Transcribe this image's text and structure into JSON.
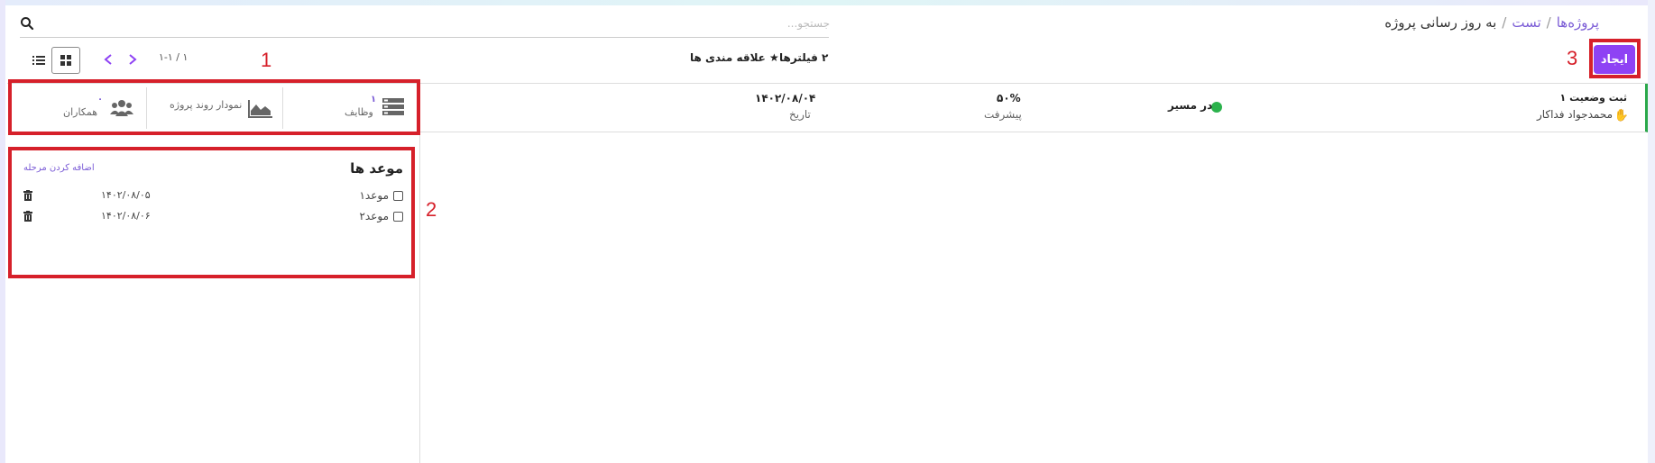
{
  "breadcrumb": {
    "root": "پروژه‌ها",
    "separator": "/",
    "project": "تست",
    "current": "به روز رسانی پروژه"
  },
  "search": {
    "placeholder": "جستجو..."
  },
  "toolbar": {
    "create_label": "ایجاد",
    "filters_label": "۲ فیلترها",
    "favorites_label": "★ علاقه مندی ها",
    "pager_text": "۱-۱ / ۱"
  },
  "annotations": {
    "one": "1",
    "two": "2",
    "three": "3"
  },
  "status_update": {
    "title": "ثبت وضعیت ۱",
    "user": "محمدجواد فداکار",
    "status": "در مسیر",
    "progress_value": "۵۰%",
    "progress_label": "پیشرفت",
    "date_value": "۱۴۰۲/۰۸/۰۴",
    "date_label": "تاریخ"
  },
  "stats": {
    "tasks_value": "۱",
    "tasks_label": "وظایف",
    "burndown_label": "نمودار روند پروژه",
    "collaborators_value": "۰",
    "collaborators_label": "همکاران"
  },
  "deadlines": {
    "title": "موعد ها",
    "add_stage": "اضافه کردن مرحله",
    "items": [
      {
        "name": "موعد۱",
        "date": "۱۴۰۲/۰۸/۰۵"
      },
      {
        "name": "موعد۲",
        "date": "۱۴۰۲/۰۸/۰۶"
      }
    ]
  },
  "colors": {
    "accent": "#8e42f4",
    "link": "#7b5cd6",
    "status_green": "#2bb24c",
    "annotation_red": "#d6202a"
  },
  "icons": [
    "search-icon",
    "chevron-left-icon",
    "chevron-right-icon",
    "kanban-view-icon",
    "list-view-icon",
    "tasks-icon",
    "area-chart-icon",
    "users-icon",
    "trash-icon",
    "hand-icon"
  ]
}
